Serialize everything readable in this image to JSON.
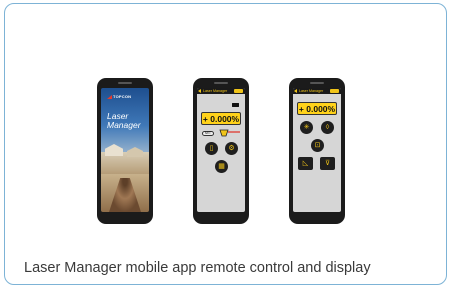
{
  "caption": "Laser Manager mobile app remote control and display",
  "colors": {
    "border": "#7db3d6",
    "accent": "#f0c419",
    "readout": "#ffd21a"
  },
  "phones": {
    "splash": {
      "logo": "TOPCON",
      "app_title": "Laser Manager"
    },
    "control": {
      "header_title": "Laser Manager",
      "readout": "+ 0.000%",
      "pill_label": "M/T",
      "buttons": [
        "remote-icon",
        "settings-icon",
        "grid-icon"
      ]
    },
    "display": {
      "header_title": "Laser Manager",
      "readout": "+ 0.000%",
      "buttons": [
        "rotation-icon",
        "direction-icon",
        "lock-icon",
        "slope-up-icon",
        "slope-down-icon"
      ]
    }
  }
}
